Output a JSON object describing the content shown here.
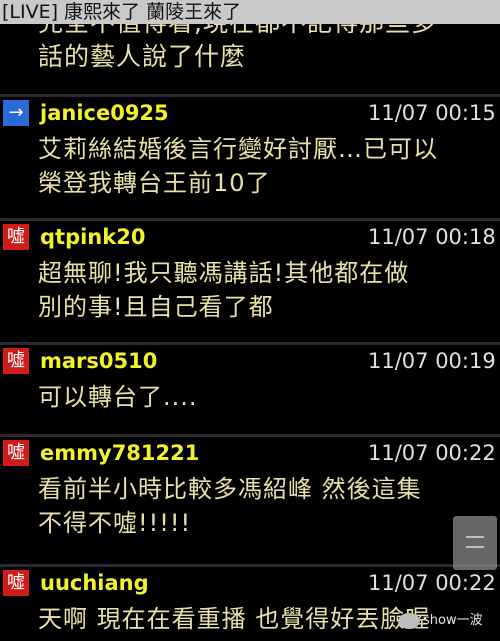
{
  "title": "[LIVE] 康熙來了 蘭陵王來了",
  "partial_post": {
    "lines": [
      "完全不值得看,現在都不記得那些多",
      "話的藝人說了什麼"
    ]
  },
  "posts": [
    {
      "tag": "→",
      "tag_color": "#2a6ad6",
      "user": "janice0925",
      "time": "11/07 00:15",
      "lines": [
        "艾莉絲結婚後言行變好討厭…已可以",
        "榮登我轉台王前10了"
      ]
    },
    {
      "tag": "噓",
      "tag_color": "#d11a1a",
      "user": "qtpink20",
      "time": "11/07 00:18",
      "lines": [
        "超無聊!我只聽馮講話!其他都在做",
        "別的事!且自己看了都"
      ]
    },
    {
      "tag": "噓",
      "tag_color": "#d11a1a",
      "user": "mars0510",
      "time": "11/07 00:19",
      "lines": [
        "可以轉台了...."
      ]
    },
    {
      "tag": "噓",
      "tag_color": "#d11a1a",
      "user": "emmy781221",
      "time": "11/07 00:22",
      "lines": [
        "看前半小時比較多馮紹峰 然後這集",
        "不得不噓!!!!!"
      ]
    },
    {
      "tag": "噓",
      "tag_color": "#d11a1a",
      "user": "uuchiang",
      "time": "11/07 00:22",
      "lines": [
        "天啊 現在在看重播 也覺得好丟臉喔"
      ]
    }
  ],
  "watermark": "show一波"
}
